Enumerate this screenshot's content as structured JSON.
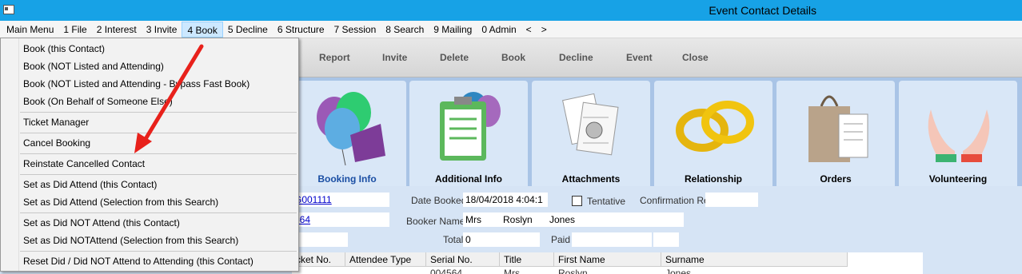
{
  "window": {
    "title": "Event Contact Details"
  },
  "menubar": {
    "items": [
      "Main Menu",
      "1 File",
      "2 Interest",
      "3 Invite",
      "4 Book",
      "5 Decline",
      "6 Structure",
      "7 Session",
      "8 Search",
      "9 Mailing",
      "0 Admin"
    ],
    "prev": "<",
    "next": ">"
  },
  "toolbar": {
    "buttons": [
      "Report",
      "Invite",
      "Delete",
      "Book",
      "Decline",
      "Event",
      "Close"
    ]
  },
  "tiles": [
    {
      "label": "Booking Info",
      "icon": "balloons-icon"
    },
    {
      "label": "Additional Info",
      "icon": "clipboard-icon"
    },
    {
      "label": "Attachments",
      "icon": "paperclip-documents-icon"
    },
    {
      "label": "Relationship",
      "icon": "rings-icon"
    },
    {
      "label": "Orders",
      "icon": "shopping-bag-icon"
    },
    {
      "label": "Volunteering",
      "icon": "hands-icon"
    }
  ],
  "form": {
    "code_value": "G001111",
    "serial_link": "564",
    "date_booked_label": "Date Booked",
    "date_booked_value": "18/04/2018 4:04:1",
    "tentative_label": "Tentative",
    "confirmation_ref_label": "Confirmation Ref",
    "booker_name_label": "Booker Name",
    "booker_title": "Mrs",
    "booker_first": "Roslyn",
    "booker_last": "Jones",
    "total_label": "Total",
    "total_value": "0",
    "paid_label": "Paid"
  },
  "grid": {
    "headers": [
      "cket No.",
      "Attendee Type",
      "Serial No.",
      "Title",
      "First Name",
      "Surname"
    ],
    "row": [
      "",
      "",
      "004564",
      "Mrs",
      "Roslyn",
      "Jones"
    ]
  },
  "dropdown": {
    "items": [
      "Book (this Contact)",
      "Book (NOT Listed and Attending)",
      "Book (NOT Listed and Attending - Bypass Fast Book)",
      "Book (On Behalf of Someone Else)",
      "Ticket Manager",
      "Cancel Booking",
      "Reinstate Cancelled Contact",
      "Set as Did Attend (this Contact)",
      "Set as Did Attend (Selection from this Search)",
      "Set as Did NOT Attend (this Contact)",
      "Set as Did NOTAttend (Selection from this Search)",
      "Reset Did / Did NOT Attend to Attending (this Contact)"
    ]
  },
  "colors": {
    "titlebar": "#17a2e6",
    "annotation_arrow": "#e8211b",
    "tile_strip": "#a9c4e6"
  }
}
